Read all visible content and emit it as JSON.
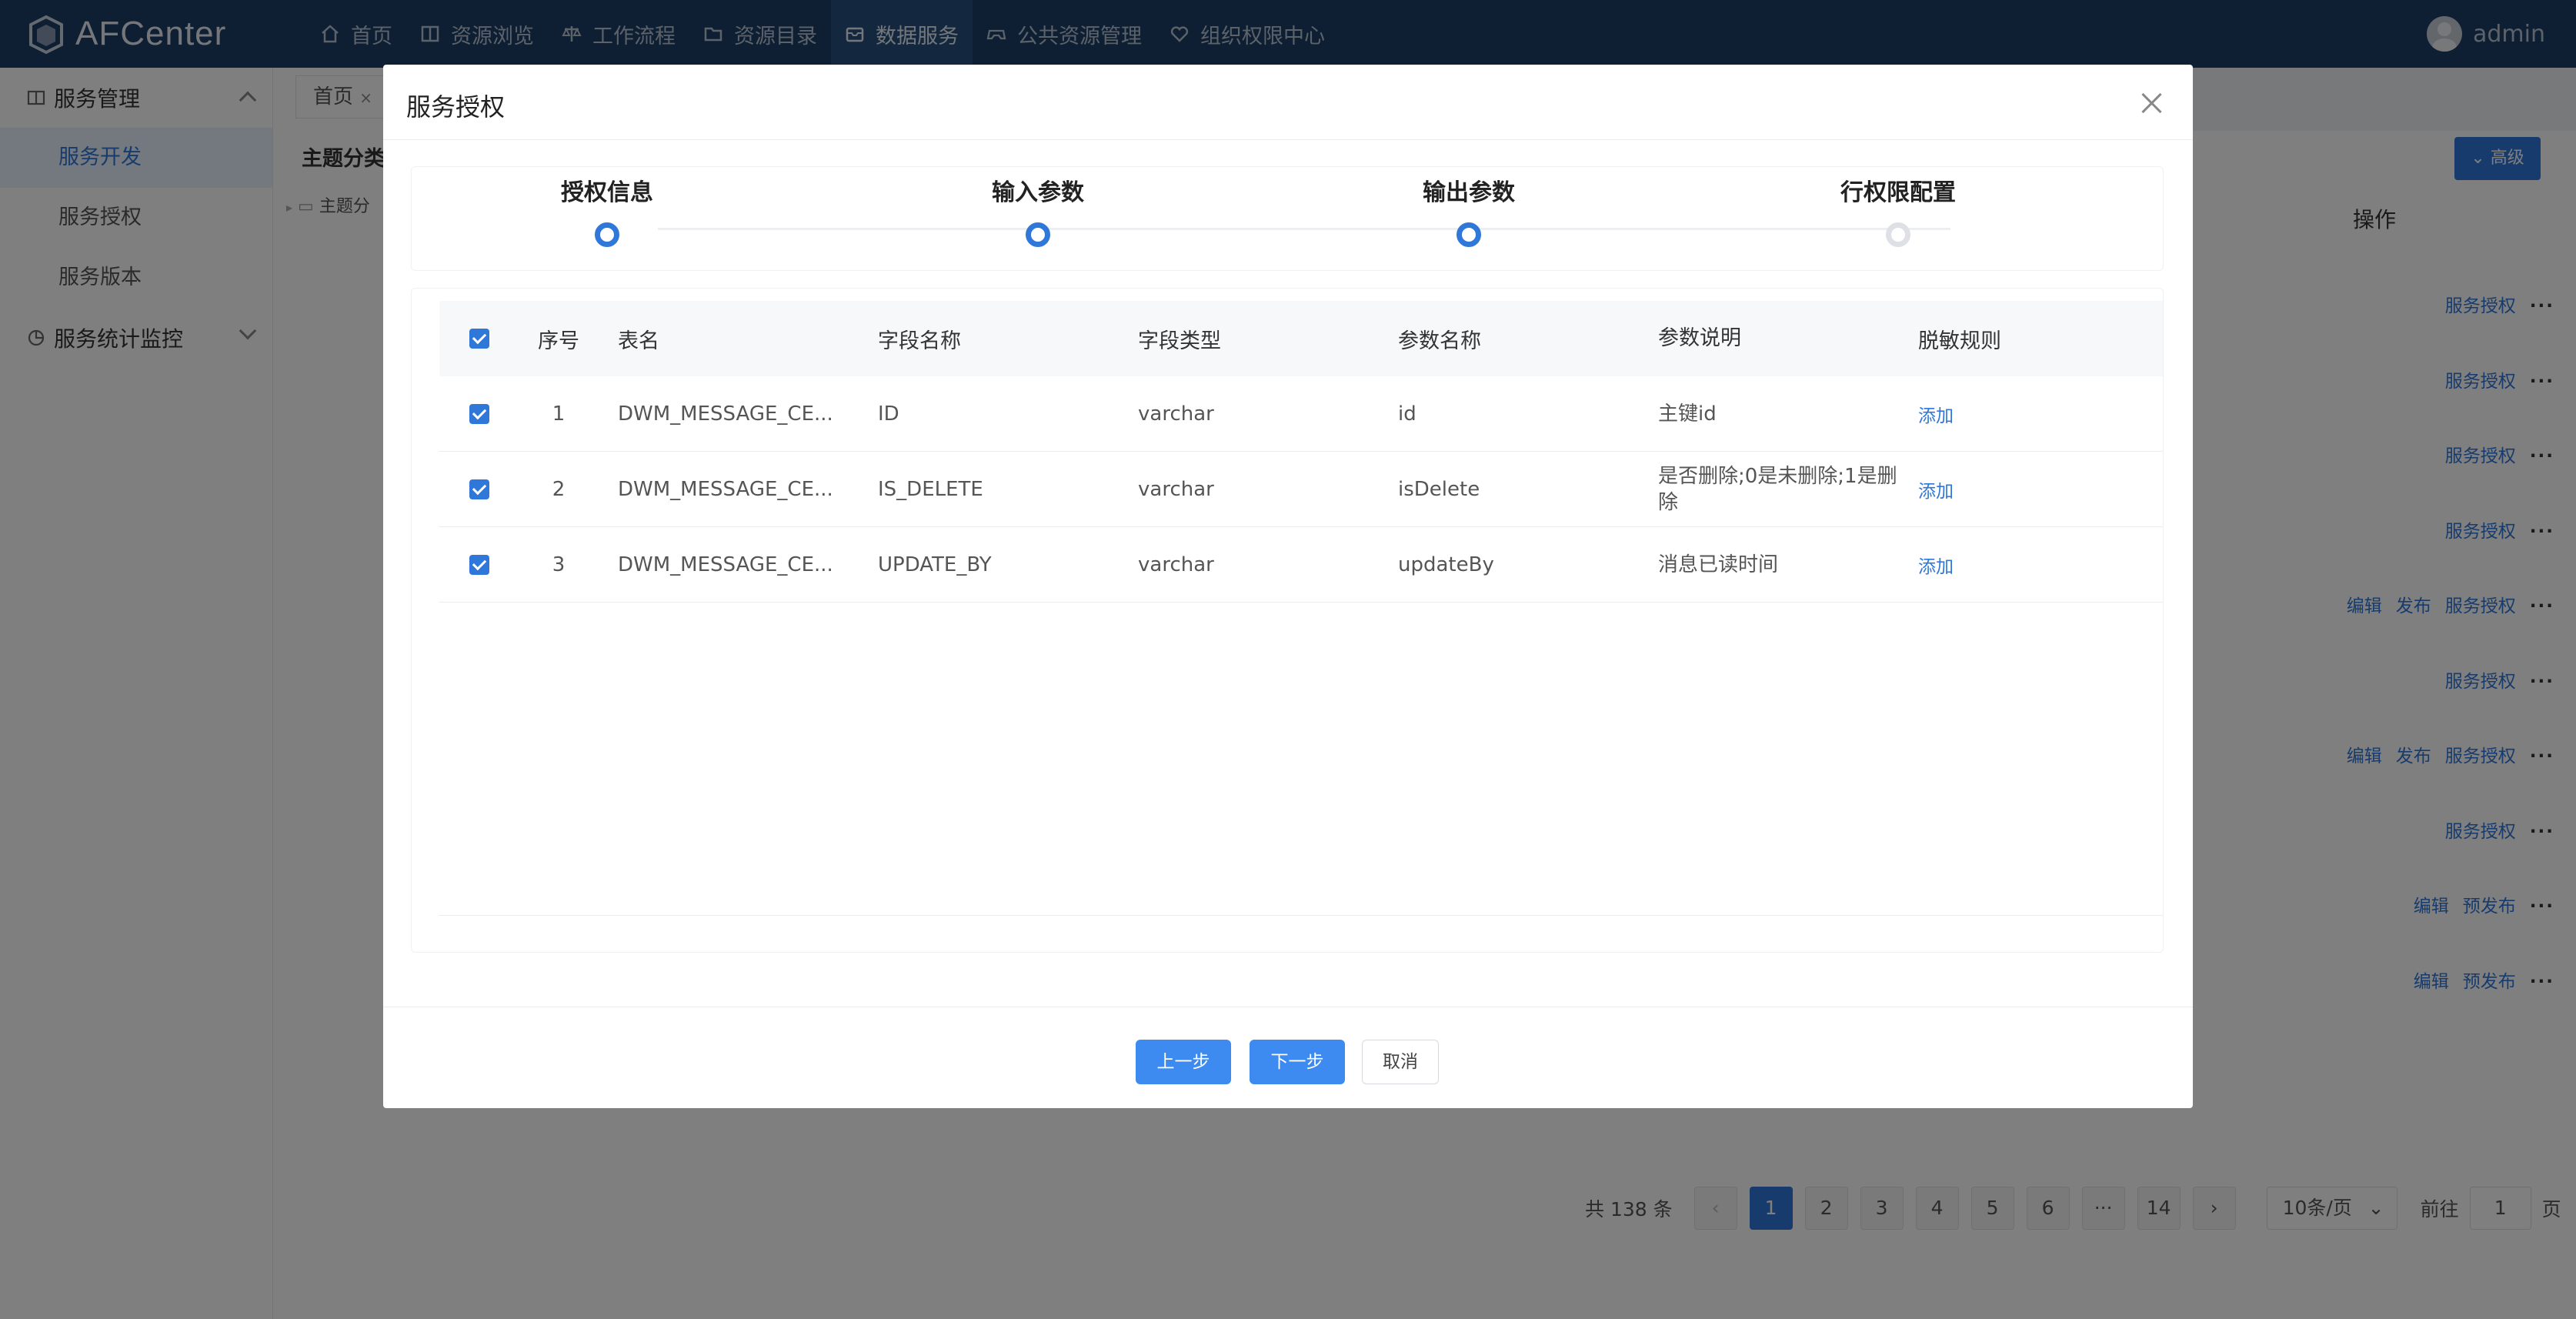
{
  "app": {
    "name": "AFCenter"
  },
  "nav": [
    {
      "label": "首页",
      "icon": "home-icon"
    },
    {
      "label": "资源浏览",
      "icon": "book-icon"
    },
    {
      "label": "工作流程",
      "icon": "balance-icon"
    },
    {
      "label": "资源目录",
      "icon": "folder-icon"
    },
    {
      "label": "数据服务",
      "icon": "box-icon",
      "active": true
    },
    {
      "label": "公共资源管理",
      "icon": "gamepad-icon"
    },
    {
      "label": "组织权限中心",
      "icon": "heart-icon"
    }
  ],
  "user": {
    "name": "admin"
  },
  "sidebar": {
    "group1": "服务管理",
    "items": [
      "服务开发",
      "服务授权",
      "服务版本"
    ],
    "group2": "服务统计监控"
  },
  "tabs": {
    "home": "首页"
  },
  "tree": {
    "title": "主题分类",
    "node": "主题分"
  },
  "toolbar": {
    "advanced": "高级"
  },
  "bg_table": {
    "op_header": "操作",
    "rows": [
      [
        "服务授权"
      ],
      [
        "服务授权"
      ],
      [
        "服务授权"
      ],
      [
        "服务授权"
      ],
      [
        "编辑",
        "发布",
        "服务授权"
      ],
      [
        "服务授权"
      ],
      [
        "编辑",
        "发布",
        "服务授权"
      ],
      [
        "服务授权"
      ],
      [
        "编辑",
        "预发布"
      ],
      [
        "编辑",
        "预发布"
      ]
    ]
  },
  "pagination": {
    "total": "共 138 条",
    "pages": [
      "1",
      "2",
      "3",
      "4",
      "5",
      "6",
      "···",
      "14"
    ],
    "current": "1",
    "size": "10条/页",
    "goto_prefix": "前往",
    "goto_value": "1",
    "goto_suffix": "页"
  },
  "dialog": {
    "title": "服务授权",
    "steps": [
      {
        "label": "授权信息",
        "state": "done"
      },
      {
        "label": "输入参数",
        "state": "done"
      },
      {
        "label": "输出参数",
        "state": "active"
      },
      {
        "label": "行权限配置",
        "state": "todo"
      }
    ],
    "columns": [
      "序号",
      "表名",
      "字段名称",
      "字段类型",
      "参数名称",
      "参数说明",
      "脱敏规则"
    ],
    "rows": [
      {
        "seq": "1",
        "table": "DWM_MESSAGE_CE...",
        "field": "ID",
        "type": "varchar",
        "param": "id",
        "desc": "主键id",
        "rule": "添加"
      },
      {
        "seq": "2",
        "table": "DWM_MESSAGE_CE...",
        "field": "IS_DELETE",
        "type": "varchar",
        "param": "isDelete",
        "desc": "是否删除;0是未删除;1是删除",
        "rule": "添加"
      },
      {
        "seq": "3",
        "table": "DWM_MESSAGE_CE...",
        "field": "UPDATE_BY",
        "type": "varchar",
        "param": "updateBy",
        "desc": "消息已读时间",
        "rule": "添加"
      }
    ],
    "buttons": {
      "prev": "上一步",
      "next": "下一步",
      "cancel": "取消"
    }
  },
  "colors": {
    "primary": "#2f77d8",
    "topbar": "#1c3d66"
  }
}
